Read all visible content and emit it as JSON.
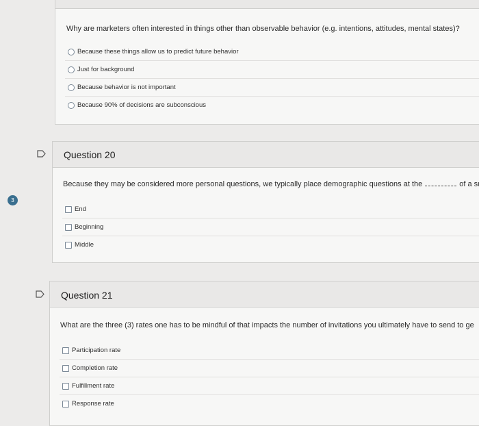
{
  "q19": {
    "text": "Why are marketers often interested in things other than observable behavior (e.g. intentions, attitudes, mental states)?",
    "options": [
      "Because these things allow us to predict future behavior",
      "Just for background",
      "Because behavior is not important",
      "Because 90% of decisions are subconscious"
    ]
  },
  "q20": {
    "title": "Question 20",
    "text_before": "Because they may be considered more personal questions, we typically place demographic questions at the",
    "text_after": "of a sur",
    "options": [
      "End",
      "Beginning",
      "Middle"
    ]
  },
  "q21": {
    "title": "Question 21",
    "text": "What are the three (3) rates one has to be mindful of that impacts the number of invitations you ultimately have to send to ge",
    "options": [
      "Participation rate",
      "Completion rate",
      "Fulfillment rate",
      "Response rate"
    ]
  },
  "badge": {
    "number": "3"
  },
  "colors": {
    "badge": "#3a6f8f",
    "card_bg": "#f7f7f6",
    "header_bg": "#e9e8e7"
  }
}
